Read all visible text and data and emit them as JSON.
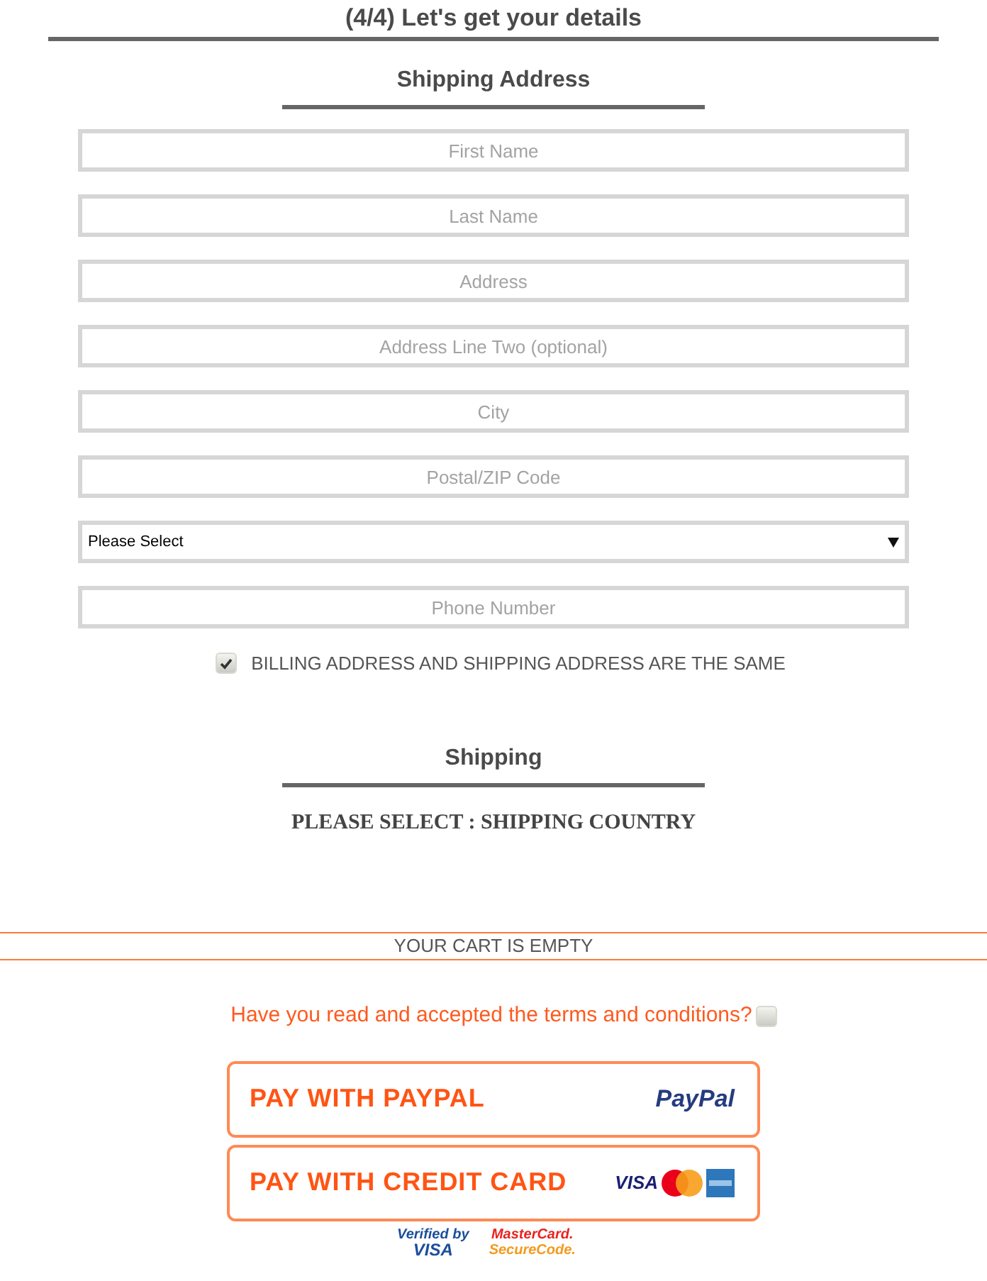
{
  "step_title": "(4/4) Let's get your details",
  "shipping_address": {
    "heading": "Shipping Address",
    "fields": [
      {
        "kind": "input",
        "placeholder": "First Name"
      },
      {
        "kind": "input",
        "placeholder": "Last Name"
      },
      {
        "kind": "input",
        "placeholder": "Address"
      },
      {
        "kind": "input",
        "placeholder": "Address Line Two (optional)"
      },
      {
        "kind": "input",
        "placeholder": "City"
      },
      {
        "kind": "input",
        "placeholder": "Postal/ZIP Code"
      },
      {
        "kind": "select",
        "value": "Please Select"
      },
      {
        "kind": "input",
        "placeholder": "Phone Number"
      }
    ],
    "same_billing": {
      "label": "BILLING ADDRESS AND SHIPPING ADDRESS ARE THE SAME",
      "checked": true
    }
  },
  "shipping": {
    "heading": "Shipping",
    "message": "PLEASE SELECT : SHIPPING COUNTRY"
  },
  "cart_status": "YOUR CART IS EMPTY",
  "terms": {
    "label": "Have you read and accepted the terms and conditions?",
    "checked": false
  },
  "payment_buttons": [
    {
      "kind": "paypal",
      "label": "PAY WITH PAYPAL",
      "logo": "PayPal"
    },
    {
      "kind": "card",
      "label": "PAY WITH CREDIT CARD",
      "logo": "VISA"
    }
  ],
  "badges": [
    {
      "kind": "visa",
      "lines": [
        "Verified by",
        "VISA"
      ]
    },
    {
      "kind": "mastercard",
      "lines": [
        "MasterCard.",
        "SecureCode."
      ]
    }
  ]
}
